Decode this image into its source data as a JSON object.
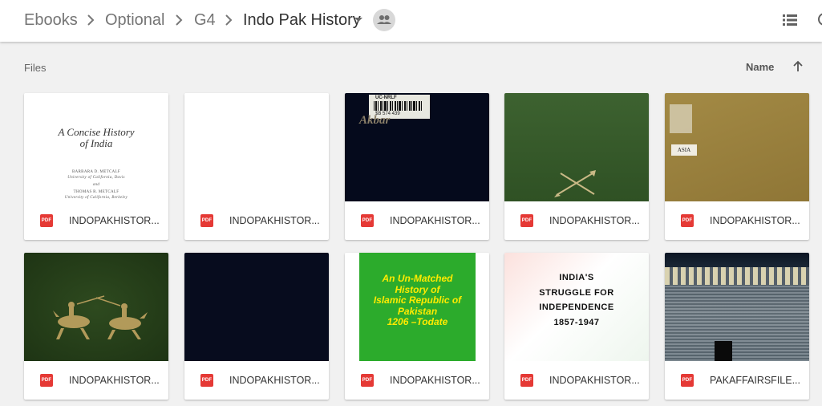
{
  "breadcrumb": {
    "items": [
      "Ebooks",
      "Optional",
      "G4"
    ],
    "current": "Indo Pak History"
  },
  "icons": {
    "separator": "chevron-right-icon",
    "dropdown": "caret-down-icon",
    "shared": "people-icon",
    "view": "list-view-icon",
    "more": "more-icon",
    "sort": "arrow-up-icon",
    "file_type": "pdf-icon"
  },
  "section": {
    "files_label": "Files"
  },
  "sort": {
    "label": "Name"
  },
  "files": [
    {
      "name": "INDOPAKHISTOR...",
      "badge": "PDF",
      "thumb": {
        "title_lines": [
          "A Concise History",
          "of India"
        ],
        "author1": "BARBARA D. METCALF",
        "author1_affil": "University of California, Davis",
        "and": "and",
        "author2": "THOMAS R. METCALF",
        "author2_affil": "University of California, Berkeley"
      }
    },
    {
      "name": "INDOPAKHISTOR...",
      "badge": "PDF"
    },
    {
      "name": "INDOPAKHISTOR...",
      "badge": "PDF",
      "thumb": {
        "barcode_top": "UC-NRLF",
        "barcode_num": "$B 574 439",
        "spine_text": "Akbar"
      }
    },
    {
      "name": "INDOPAKHISTOR...",
      "badge": "PDF"
    },
    {
      "name": "INDOPAKHISTOR...",
      "badge": "PDF",
      "thumb": {
        "label": "ASIA"
      }
    },
    {
      "name": "INDOPAKHISTOR...",
      "badge": "PDF"
    },
    {
      "name": "INDOPAKHISTOR...",
      "badge": "PDF"
    },
    {
      "name": "INDOPAKHISTOR...",
      "badge": "PDF",
      "thumb": {
        "title_lines": [
          "An Un-Matched",
          "History of",
          "Islamic Republic of",
          "Pakistan",
          "1206 –Todate"
        ]
      }
    },
    {
      "name": "INDOPAKHISTOR...",
      "badge": "PDF",
      "thumb": {
        "title_lines": [
          "INDIA'S",
          "STRUGGLE FOR",
          "INDEPENDENCE",
          "1857-1947"
        ]
      }
    },
    {
      "name": "PAKAFFAIRSFILE...",
      "badge": "PDF"
    }
  ],
  "colors": {
    "pdf_badge": "#e53935",
    "accent_text": "#333333"
  }
}
